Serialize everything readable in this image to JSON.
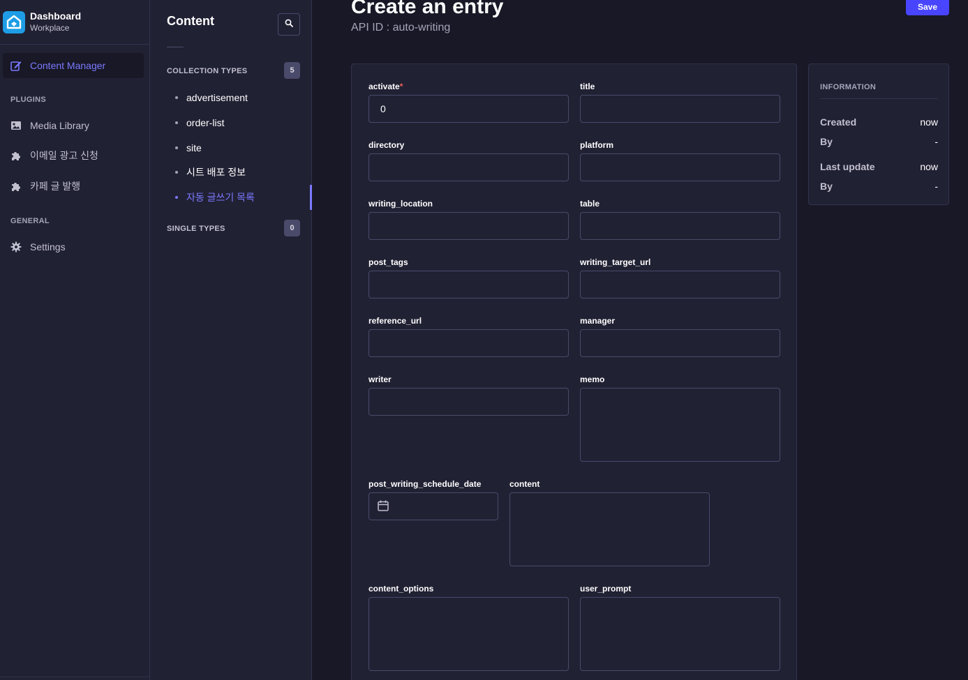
{
  "brand": {
    "title": "Dashboard",
    "subtitle": "Workplace"
  },
  "mainnav": {
    "content_manager": "Content Manager",
    "plugins_header": "PLUGINS",
    "plugins": [
      "Media Library",
      "이메일 광고 신청",
      "카페 글 발행"
    ],
    "general_header": "GENERAL",
    "settings": "Settings"
  },
  "subnav": {
    "title": "Content",
    "collection_header": "COLLECTION TYPES",
    "collection_count": "5",
    "collection_items": [
      "advertisement",
      "order-list",
      "site",
      "시트 배포 정보",
      "자동 글쓰기 목록"
    ],
    "single_header": "SINGLE TYPES",
    "single_count": "0"
  },
  "header": {
    "title": "Create an entry",
    "api_id": "API ID : auto-writing",
    "save_label": "Save"
  },
  "form": {
    "activate_label": "activate",
    "activate_required": "*",
    "activate_value": "0",
    "title_label": "title",
    "directory_label": "directory",
    "platform_label": "platform",
    "writing_location_label": "writing_location",
    "table_label": "table",
    "post_tags_label": "post_tags",
    "writing_target_url_label": "writing_target_url",
    "reference_url_label": "reference_url",
    "manager_label": "manager",
    "writer_label": "writer",
    "memo_label": "memo",
    "schedule_label": "post_writing_schedule_date",
    "content_label": "content",
    "content_options_label": "content_options",
    "user_prompt_label": "user_prompt"
  },
  "info": {
    "header": "INFORMATION",
    "created_key": "Created",
    "created_val": "now",
    "by1_key": "By",
    "by1_val": "-",
    "updated_key": "Last update",
    "updated_val": "now",
    "by2_key": "By",
    "by2_val": "-"
  },
  "colors": {
    "accent": "#7b79ff",
    "primary": "#4945ff",
    "required": "#ee5e52"
  }
}
